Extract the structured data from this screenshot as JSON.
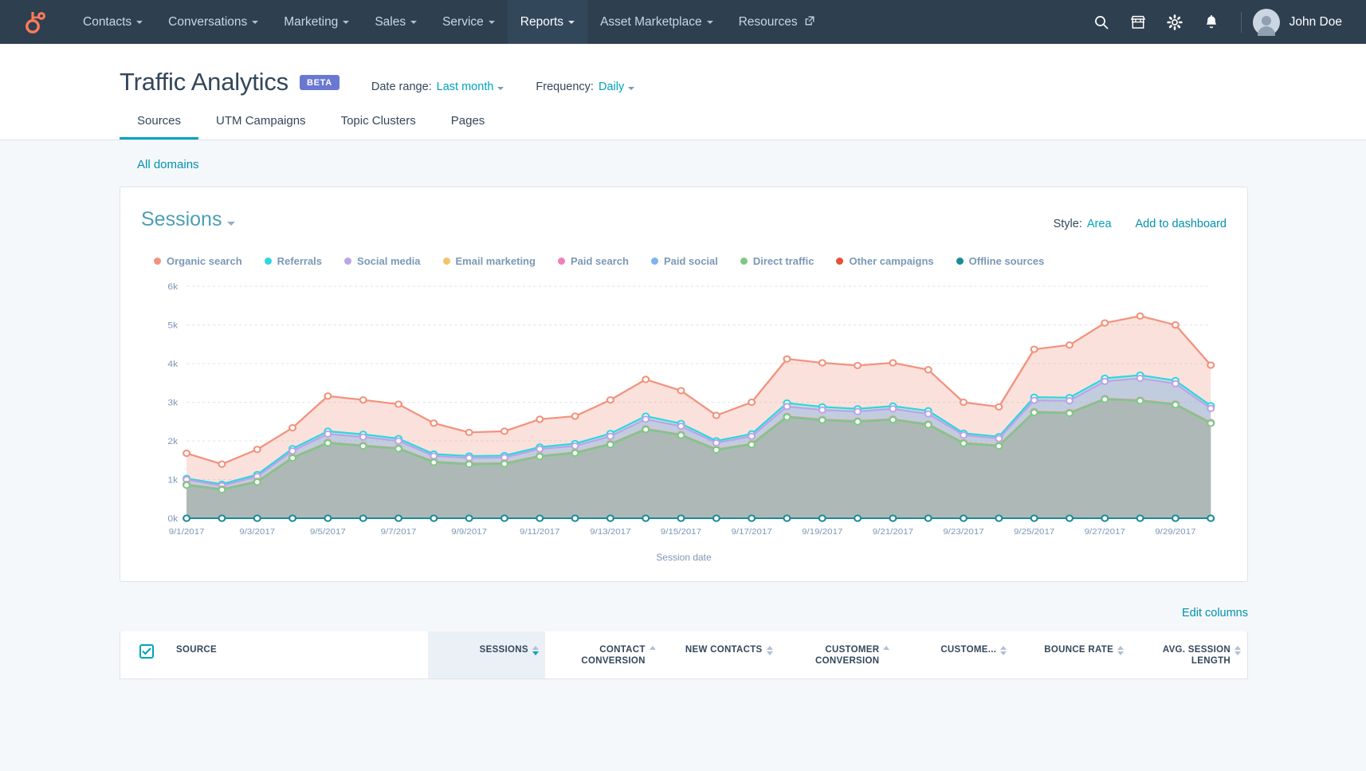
{
  "nav": {
    "logo_icon": "hubspot-sprocket-logo",
    "items": [
      {
        "label": "Contacts",
        "has_caret": true,
        "active": false
      },
      {
        "label": "Conversations",
        "has_caret": true,
        "active": false
      },
      {
        "label": "Marketing",
        "has_caret": true,
        "active": false
      },
      {
        "label": "Sales",
        "has_caret": true,
        "active": false
      },
      {
        "label": "Service",
        "has_caret": true,
        "active": false
      },
      {
        "label": "Reports",
        "has_caret": true,
        "active": true
      },
      {
        "label": "Asset Marketplace",
        "has_caret": true,
        "active": false
      },
      {
        "label": "Resources",
        "has_caret": false,
        "active": false
      }
    ],
    "icons": [
      "search-icon",
      "marketplace-icon",
      "gear-icon",
      "notifications-icon"
    ],
    "user": "John Doe"
  },
  "header": {
    "title": "Traffic Analytics",
    "badge": "BETA",
    "date_range_label": "Date range:",
    "date_range_value": "Last month",
    "frequency_label": "Frequency:",
    "frequency_value": "Daily"
  },
  "tabs": [
    {
      "label": "Sources",
      "active": true
    },
    {
      "label": "UTM Campaigns",
      "active": false
    },
    {
      "label": "Topic Clusters",
      "active": false
    },
    {
      "label": "Pages",
      "active": false
    }
  ],
  "filters": {
    "domains": "All domains"
  },
  "card": {
    "metric_title": "Sessions",
    "style_label": "Style:",
    "style_value": "Area",
    "add_to_dashboard": "Add to dashboard"
  },
  "table_controls": {
    "edit_columns": "Edit columns"
  },
  "table": {
    "columns": [
      {
        "label": "SOURCE",
        "sortable": false,
        "sorted": false
      },
      {
        "label": "SESSIONS",
        "sortable": true,
        "sorted": true
      },
      {
        "label": "CONTACT CONVERSION",
        "sortable": true,
        "sorted": false
      },
      {
        "label": "NEW CONTACTS",
        "sortable": true,
        "sorted": false
      },
      {
        "label": "CUSTOMER CONVERSION",
        "sortable": true,
        "sorted": false
      },
      {
        "label": "CUSTOME...",
        "sortable": true,
        "sorted": false
      },
      {
        "label": "BOUNCE RATE",
        "sortable": true,
        "sorted": false
      },
      {
        "label": "AVG. SESSION LENGTH",
        "sortable": true,
        "sorted": false
      }
    ]
  },
  "chart_data": {
    "type": "area",
    "stacked": true,
    "title": "Sessions",
    "xlabel": "Session date",
    "ylabel": "",
    "ylim": [
      0,
      6000
    ],
    "yticks": [
      0,
      1000,
      2000,
      3000,
      4000,
      5000,
      6000
    ],
    "ytick_labels": [
      "0k",
      "1k",
      "2k",
      "3k",
      "4k",
      "5k",
      "6k"
    ],
    "grid": true,
    "legend_position": "top-left",
    "x": [
      "9/1/2017",
      "9/2/2017",
      "9/3/2017",
      "9/4/2017",
      "9/5/2017",
      "9/6/2017",
      "9/7/2017",
      "9/8/2017",
      "9/9/2017",
      "9/10/2017",
      "9/11/2017",
      "9/12/2017",
      "9/13/2017",
      "9/14/2017",
      "9/15/2017",
      "9/16/2017",
      "9/17/2017",
      "9/18/2017",
      "9/19/2017",
      "9/20/2017",
      "9/21/2017",
      "9/22/2017",
      "9/23/2017",
      "9/24/2017",
      "9/25/2017",
      "9/26/2017",
      "9/27/2017",
      "9/28/2017",
      "9/29/2017",
      "9/30/2017"
    ],
    "xtick_labels": [
      "9/1/2017",
      "9/3/2017",
      "9/5/2017",
      "9/7/2017",
      "9/9/2017",
      "9/11/2017",
      "9/13/2017",
      "9/15/2017",
      "9/17/2017",
      "9/19/2017",
      "9/21/2017",
      "9/23/2017",
      "9/25/2017",
      "9/27/2017",
      "9/29/2017"
    ],
    "cumulative_series": [
      {
        "name": "Organic search",
        "color": "#f2927d",
        "values": [
          1680,
          1400,
          1780,
          2340,
          3160,
          3060,
          2950,
          2460,
          2220,
          2250,
          2560,
          2640,
          3060,
          3590,
          3300,
          2660,
          3000,
          4120,
          4020,
          3950,
          4020,
          3840,
          3000,
          2880,
          4370,
          4480,
          5050,
          5230,
          5000,
          3960
        ]
      },
      {
        "name": "Referrals",
        "color": "#2fd6e0",
        "values": [
          1030,
          880,
          1130,
          1800,
          2250,
          2170,
          2060,
          1660,
          1610,
          1620,
          1840,
          1930,
          2190,
          2640,
          2450,
          2000,
          2180,
          2980,
          2880,
          2830,
          2900,
          2780,
          2200,
          2110,
          3130,
          3120,
          3620,
          3700,
          3560,
          2910
        ]
      },
      {
        "name": "Social media",
        "color": "#bda3e8",
        "values": [
          1000,
          840,
          1080,
          1740,
          2180,
          2100,
          2000,
          1610,
          1560,
          1570,
          1790,
          1870,
          2120,
          2560,
          2380,
          1950,
          2120,
          2890,
          2800,
          2760,
          2830,
          2700,
          2150,
          2060,
          3050,
          3040,
          3540,
          3620,
          3480,
          2840
        ]
      },
      {
        "name": "Email marketing",
        "color": "#f5c26b",
        "values": [
          880,
          760,
          960,
          1580,
          1970,
          1890,
          1820,
          1470,
          1420,
          1430,
          1620,
          1710,
          1930,
          2320,
          2170,
          1790,
          1930,
          2640,
          2560,
          2520,
          2570,
          2440,
          1960,
          1890,
          2760,
          2740,
          3100,
          3060,
          2960,
          2480
        ]
      },
      {
        "name": "Paid search",
        "color": "#f17eb8",
        "values": [
          870,
          750,
          950,
          1570,
          1960,
          1880,
          1810,
          1460,
          1410,
          1420,
          1610,
          1700,
          1920,
          2310,
          2160,
          1780,
          1920,
          2630,
          2550,
          2510,
          2560,
          2430,
          1950,
          1880,
          2750,
          2730,
          3090,
          3050,
          2950,
          2470
        ]
      },
      {
        "name": "Paid social",
        "color": "#7fb2f0",
        "values": [
          865,
          745,
          945,
          1565,
          1955,
          1875,
          1805,
          1455,
          1405,
          1415,
          1605,
          1695,
          1915,
          2305,
          2155,
          1775,
          1915,
          2625,
          2545,
          2505,
          2555,
          2425,
          1945,
          1875,
          2745,
          2725,
          3085,
          3045,
          2945,
          2465
        ]
      },
      {
        "name": "Direct traffic",
        "color": "#81c784",
        "values": [
          855,
          735,
          935,
          1555,
          1945,
          1865,
          1795,
          1445,
          1395,
          1405,
          1595,
          1685,
          1905,
          2295,
          2145,
          1765,
          1905,
          2615,
          2535,
          2495,
          2545,
          2415,
          1935,
          1865,
          2735,
          2715,
          3075,
          3035,
          2935,
          2455
        ]
      },
      {
        "name": "Other campaigns",
        "color": "#e8503a",
        "values": [
          0,
          0,
          0,
          0,
          0,
          0,
          0,
          0,
          0,
          0,
          0,
          0,
          0,
          0,
          0,
          0,
          0,
          0,
          0,
          0,
          0,
          0,
          0,
          0,
          0,
          0,
          0,
          0,
          0,
          0
        ]
      },
      {
        "name": "Offline sources",
        "color": "#1d8a99",
        "values": [
          0,
          0,
          0,
          0,
          0,
          0,
          0,
          0,
          0,
          0,
          0,
          0,
          0,
          0,
          0,
          0,
          0,
          0,
          0,
          0,
          0,
          0,
          0,
          0,
          0,
          0,
          0,
          0,
          0,
          0
        ]
      }
    ]
  }
}
